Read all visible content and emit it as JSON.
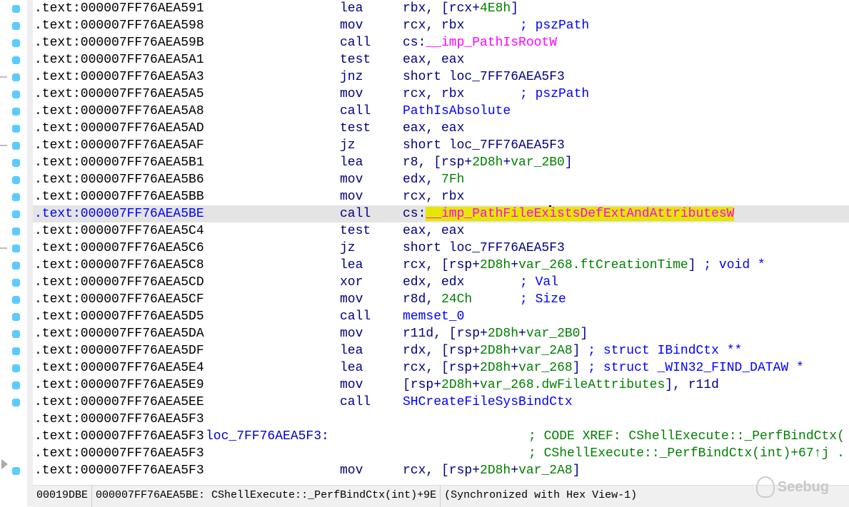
{
  "rows": [
    {
      "addr": ".text:000007FF76AEA591",
      "mn": "lea",
      "ops": [
        [
          "rbx, [rcx+",
          "n"
        ],
        [
          "4E8h",
          "g"
        ],
        [
          "]",
          "n"
        ]
      ]
    },
    {
      "addr": ".text:000007FF76AEA598",
      "mn": "mov",
      "ops": [
        [
          "rcx, rbx",
          "n"
        ]
      ],
      "comment": "; pszPath",
      "cpos": "682"
    },
    {
      "addr": ".text:000007FF76AEA59B",
      "mn": "call",
      "ops": [
        [
          "cs:",
          "n"
        ],
        [
          "__imp_PathIsRootW",
          "m"
        ]
      ]
    },
    {
      "addr": ".text:000007FF76AEA5A1",
      "mn": "test",
      "ops": [
        [
          "eax, eax",
          "n"
        ]
      ]
    },
    {
      "addr": ".text:000007FF76AEA5A3",
      "mn": "jnz",
      "ops": [
        [
          "short loc_7FF76AEA5F3",
          "n"
        ]
      ]
    },
    {
      "addr": ".text:000007FF76AEA5A5",
      "mn": "mov",
      "ops": [
        [
          "rcx, rbx",
          "n"
        ]
      ],
      "comment": "; pszPath",
      "cpos": "682"
    },
    {
      "addr": ".text:000007FF76AEA5A8",
      "mn": "call",
      "ops": [
        [
          "PathIsAbsolute",
          "b"
        ]
      ]
    },
    {
      "addr": ".text:000007FF76AEA5AD",
      "mn": "test",
      "ops": [
        [
          "eax, eax",
          "n"
        ]
      ]
    },
    {
      "addr": ".text:000007FF76AEA5AF",
      "mn": "jz",
      "ops": [
        [
          "short loc_7FF76AEA5F3",
          "n"
        ]
      ]
    },
    {
      "addr": ".text:000007FF76AEA5B1",
      "mn": "lea",
      "ops": [
        [
          "r8, [rsp+",
          "n"
        ],
        [
          "2D8h",
          "g"
        ],
        [
          "+",
          "n"
        ],
        [
          "var_2B0",
          "g"
        ],
        [
          "]",
          "n"
        ]
      ]
    },
    {
      "addr": ".text:000007FF76AEA5B6",
      "mn": "mov",
      "ops": [
        [
          "edx, ",
          "n"
        ],
        [
          "7Fh",
          "g"
        ]
      ]
    },
    {
      "addr": ".text:000007FF76AEA5BB",
      "mn": "mov",
      "ops": [
        [
          "rcx, rbx",
          "n"
        ]
      ]
    },
    {
      "addr": ".text:000007FF76AEA5BE",
      "mn": "call",
      "selected": true,
      "ops": [
        [
          "cs:",
          "n"
        ],
        [
          "__imp_PathFileEx",
          "m hl"
        ],
        [
          "|",
          "cursor"
        ],
        [
          "istsDefExtAndAttributesW",
          "m hl"
        ]
      ]
    },
    {
      "addr": ".text:000007FF76AEA5C4",
      "mn": "test",
      "ops": [
        [
          "eax, eax",
          "n"
        ]
      ]
    },
    {
      "addr": ".text:000007FF76AEA5C6",
      "mn": "jz",
      "ops": [
        [
          "short loc_7FF76AEA5F3",
          "n"
        ]
      ]
    },
    {
      "addr": ".text:000007FF76AEA5C8",
      "mn": "lea",
      "ops": [
        [
          "rcx, [rsp+",
          "n"
        ],
        [
          "2D8h",
          "g"
        ],
        [
          "+",
          "n"
        ],
        [
          "var_268.ftCreationTime",
          "g"
        ],
        [
          "]",
          "n"
        ],
        [
          " ; void *",
          "b"
        ]
      ]
    },
    {
      "addr": ".text:000007FF76AEA5CD",
      "mn": "xor",
      "ops": [
        [
          "edx, edx",
          "n"
        ]
      ],
      "comment": "; Val",
      "cpos": "682"
    },
    {
      "addr": ".text:000007FF76AEA5CF",
      "mn": "mov",
      "ops": [
        [
          "r8d, ",
          "n"
        ],
        [
          "24Ch",
          "g"
        ]
      ],
      "comment": "; Size",
      "cpos": "682"
    },
    {
      "addr": ".text:000007FF76AEA5D5",
      "mn": "call",
      "ops": [
        [
          "memset_0",
          "b"
        ]
      ]
    },
    {
      "addr": ".text:000007FF76AEA5DA",
      "mn": "mov",
      "ops": [
        [
          "r11d, [rsp+",
          "n"
        ],
        [
          "2D8h",
          "g"
        ],
        [
          "+",
          "n"
        ],
        [
          "var_2B0",
          "g"
        ],
        [
          "]",
          "n"
        ]
      ]
    },
    {
      "addr": ".text:000007FF76AEA5DF",
      "mn": "lea",
      "ops": [
        [
          "rdx, [rsp+",
          "n"
        ],
        [
          "2D8h",
          "g"
        ],
        [
          "+",
          "n"
        ],
        [
          "var_2A8",
          "g"
        ],
        [
          "]",
          "n"
        ],
        [
          " ; struct IBindCtx **",
          "b"
        ]
      ]
    },
    {
      "addr": ".text:000007FF76AEA5E4",
      "mn": "lea",
      "ops": [
        [
          "rcx, [rsp+",
          "n"
        ],
        [
          "2D8h",
          "g"
        ],
        [
          "+",
          "n"
        ],
        [
          "var_268",
          "g"
        ],
        [
          "]",
          "n"
        ],
        [
          " ; struct _WIN32_FIND_DATAW *",
          "b"
        ]
      ]
    },
    {
      "addr": ".text:000007FF76AEA5E9",
      "mn": "mov",
      "ops": [
        [
          "[rsp+",
          "n"
        ],
        [
          "2D8h",
          "g"
        ],
        [
          "+",
          "n"
        ],
        [
          "var_268.dwFileAttributes",
          "g"
        ],
        [
          "], r11d",
          "n"
        ]
      ]
    },
    {
      "addr": ".text:000007FF76AEA5EE",
      "mn": "call",
      "ops": [
        [
          "SHCreateFileSysBindCtx",
          "b"
        ]
      ]
    },
    {
      "addr": ".text:000007FF76AEA5F3"
    },
    {
      "addr": ".text:000007FF76AEA5F3",
      "label": "loc_7FF76AEA5F3:",
      "xref": "; CODE XREF: CShellExecute::_PerfBindCtx("
    },
    {
      "addr": ".text:000007FF76AEA5F3",
      "xref": "; CShellExecute::_PerfBindCtx(int)+67↑j ."
    },
    {
      "addr": ".text:000007FF76AEA5F3",
      "mn": "mov",
      "ops": [
        [
          "rcx, [rsp+",
          "n"
        ],
        [
          "2D8h",
          "g"
        ],
        [
          "+",
          "n"
        ],
        [
          "var_2A8",
          "g"
        ],
        [
          "]",
          "n"
        ]
      ]
    }
  ],
  "status": {
    "offset": "00019DBE",
    "location": "000007FF76AEA5BE: CShellExecute::_PerfBindCtx(int)+9E",
    "sync": "(Synchronized with Hex View-1)"
  },
  "watermark": "Seebug"
}
